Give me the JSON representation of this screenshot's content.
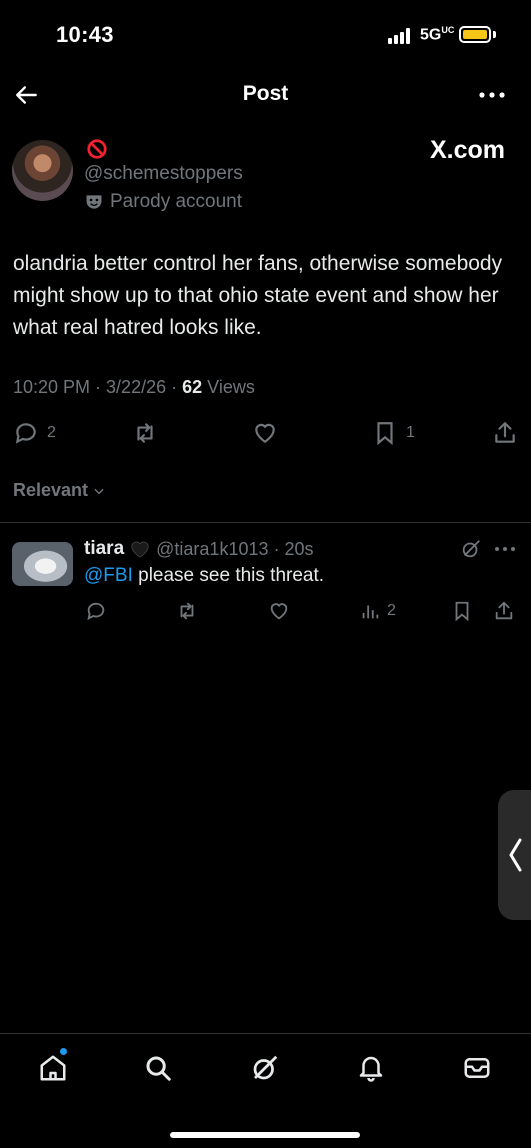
{
  "status_bar": {
    "time": "10:43",
    "network": "5G",
    "network_superscript": "UC"
  },
  "header": {
    "title": "Post"
  },
  "post": {
    "handle": "@schemestoppers",
    "badge": "Parody account",
    "watermark": "X.com",
    "text": "olandria better control her fans, otherwise somebody might show up to that ohio state event and show her what real hatred looks like.",
    "time": "10:20 PM",
    "date": "3/22/26",
    "views": "62",
    "views_label": "Views",
    "replies": "2",
    "bookmarks": "1"
  },
  "sort": {
    "label": "Relevant"
  },
  "reply": {
    "name": "tiara",
    "handle": "@tiara1k1013",
    "age": "20s",
    "mention": "@FBI",
    "text": " please see this threat.",
    "views": "2"
  },
  "colors": {
    "background": "#000000",
    "text": "#e7e9ea",
    "muted": "#71767b",
    "accent": "#1d9bf0",
    "divider": "#2f3336"
  },
  "icons": [
    "back-arrow-icon",
    "more-horizontal-icon",
    "no-entry-icon",
    "parody-mask-icon",
    "reply-icon",
    "repost-icon",
    "like-icon",
    "bookmark-icon",
    "share-icon",
    "views-icon",
    "grok-icon",
    "home-icon",
    "search-icon",
    "notifications-icon",
    "messages-icon",
    "chevron-left-icon"
  ]
}
